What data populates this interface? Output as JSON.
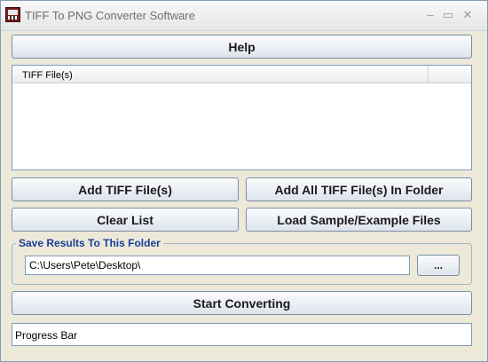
{
  "window": {
    "title": "TIFF To PNG Converter Software",
    "controls": {
      "minimize": "–",
      "maximize": "▭",
      "close": "✕"
    }
  },
  "toolbar": {
    "help_label": "Help"
  },
  "file_list": {
    "columns": [
      "TIFF File(s)"
    ],
    "rows": []
  },
  "actions": {
    "add_files_label": "Add TIFF File(s)",
    "add_folder_label": "Add All TIFF File(s) In Folder",
    "clear_list_label": "Clear List",
    "load_sample_label": "Load Sample/Example Files"
  },
  "output": {
    "group_label": "Save Results To This Folder",
    "folder_path": "C:\\Users\\Pete\\Desktop\\",
    "browse_label": "..."
  },
  "convert": {
    "start_label": "Start Converting"
  },
  "progress": {
    "label": "Progress Bar",
    "value": 0
  },
  "colors": {
    "group_label": "#1a3e9a",
    "border": "#7f9db9"
  }
}
